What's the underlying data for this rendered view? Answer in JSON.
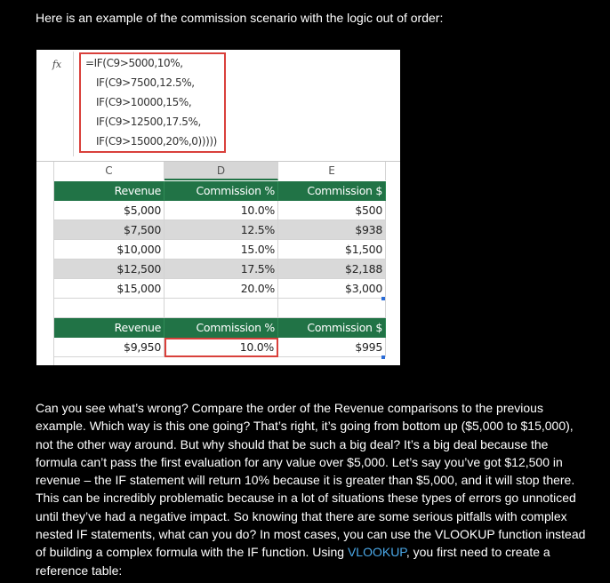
{
  "intro": "Here is an example of the commission scenario with the logic out of order:",
  "formula_bar": {
    "fx_icon": "fx",
    "lines": [
      "=IF(C9>5000,10%,",
      "IF(C9>7500,12.5%,",
      "IF(C9>10000,15%,",
      "IF(C9>12500,17.5%,",
      "IF(C9>15000,20%,0)))))"
    ]
  },
  "columns": [
    "C",
    "D",
    "E"
  ],
  "table1": {
    "headers": [
      "Revenue",
      "Commission %",
      "Commission $"
    ],
    "rows": [
      [
        "$5,000",
        "10.0%",
        "$500"
      ],
      [
        "$7,500",
        "12.5%",
        "$938"
      ],
      [
        "$10,000",
        "15.0%",
        "$1,500"
      ],
      [
        "$12,500",
        "17.5%",
        "$2,188"
      ],
      [
        "$15,000",
        "20.0%",
        "$3,000"
      ]
    ]
  },
  "table2": {
    "headers": [
      "Revenue",
      "Commission %",
      "Commission $"
    ],
    "row": [
      "$9,950",
      "10.0%",
      "$995"
    ]
  },
  "paragraph": {
    "before_link": "Can you see what’s wrong? Compare the order of the Revenue comparisons to the previous example. Which way is this one going? That’s right, it’s going from bottom up ($5,000 to $15,000), not the other way around. But why should that be such a big deal? It’s a big deal because the formula can’t pass the first evaluation for any value over $5,000. Let’s say you’ve got $12,500 in revenue – the IF statement will return 10% because it is greater than $5,000, and it will stop there. This can be incredibly problematic because in a lot of situations these types of errors go unnoticed until they’ve had a negative impact. So knowing that there are some serious pitfalls with complex nested IF statements, what can you do? In most cases, you can use the VLOOKUP function instead of building a complex formula with the IF function. Using ",
    "link": "VLOOKUP",
    "after_link": ", you first need to create a reference table:"
  },
  "colors": {
    "header_green": "#217346",
    "highlight_red": "#d9403b",
    "link_blue": "#4aa8e8"
  }
}
